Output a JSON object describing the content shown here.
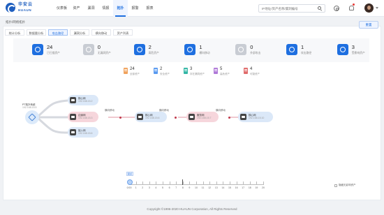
{
  "brand": {
    "name_cn": "华安云",
    "name_en": "HUAUN"
  },
  "nav": {
    "items": [
      "仪表板",
      "资产",
      "漏洞",
      "情报",
      "拓扑",
      "报警",
      "报表"
    ],
    "active_index": 4
  },
  "search": {
    "placeholder": "IP地址/资产名称/漏洞编号"
  },
  "breadcrumb": "拓扑/网络拓扑",
  "tabs": {
    "items": [
      "统计分析",
      "数据量分析",
      "攻击路径",
      "漏洞分析",
      "横向移动",
      "资产列表"
    ],
    "active_index": 2
  },
  "reset_label": "重置",
  "stats": [
    {
      "value": "24",
      "label": "已扫描资产",
      "icon": "compass-icon",
      "muted": false
    },
    {
      "value": "0",
      "label": "无漏洞资产",
      "icon": "server-icon",
      "muted": true
    },
    {
      "value": "2",
      "label": "高危资产",
      "icon": "send-icon",
      "muted": false
    },
    {
      "value": "1",
      "label": "横向移动",
      "icon": "book-icon",
      "muted": false
    },
    {
      "value": "0",
      "label": "外部攻击",
      "icon": "import-icon",
      "muted": true
    },
    {
      "value": "1",
      "label": "攻击路径",
      "icon": "network-icon",
      "muted": false
    },
    {
      "value": "3",
      "label": "受影响资产",
      "icon": "check-circle-icon",
      "muted": false
    }
  ],
  "legend": [
    {
      "value": "24",
      "label": "全部资产",
      "color": "#f0a35e"
    },
    {
      "value": "2",
      "label": "安全资产",
      "color": "#5b9bf0"
    },
    {
      "value": "3",
      "label": "存在漏洞资产",
      "color": "#35b7a6"
    },
    {
      "value": "5",
      "label": "高危资产",
      "color": "#b07ad8"
    },
    {
      "value": "4",
      "label": "可疑资产",
      "color": "#e06c6c"
    }
  ],
  "topology": {
    "root": {
      "name": "PT拓扑系统",
      "ip": "192.168.15.5"
    },
    "nodes": [
      {
        "name": "核心网",
        "ip": "192.168.15.2",
        "kind": "normal"
      },
      {
        "name": "边缘网",
        "ip": "192.168.15.3",
        "kind": "danger"
      },
      {
        "name": "接入网",
        "ip": "192.168.15.6",
        "kind": "normal"
      },
      {
        "name": "核心网",
        "ip": "192.168.15.6",
        "kind": "normal"
      },
      {
        "name": "服务网",
        "ip": "192.168.15.7",
        "kind": "danger"
      },
      {
        "name": "核心网",
        "ip": "192.168.15.10",
        "kind": "normal"
      }
    ],
    "edge_label": "横向移动"
  },
  "timeline": {
    "marks": [
      "0/15",
      "1",
      "2",
      "3",
      "4",
      "5",
      "6",
      "7",
      "8",
      "9",
      "10",
      "11",
      "12",
      "13",
      "14",
      "15",
      "16",
      "17",
      "18",
      "19",
      "20"
    ],
    "flag": "起点",
    "checkbox_label": "隐藏无影响资产"
  },
  "footer": "Copyright ©1996-2020 HUAUN Corporation, All Rights Reserved"
}
